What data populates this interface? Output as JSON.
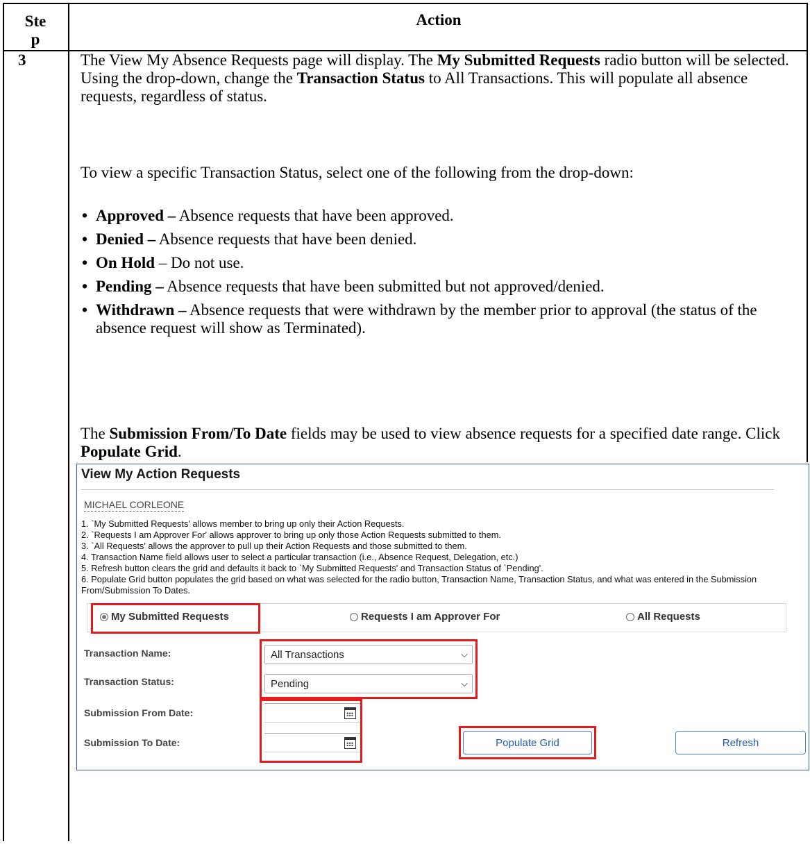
{
  "table": {
    "header_step_part1": "Ste",
    "header_step_part2": "p",
    "header_action": "Action",
    "step_number": "3"
  },
  "instructions": {
    "para1": {
      "t1": "The View My Absence Requests page will display.  The ",
      "b1": "My Submitted Requests",
      "t2": " radio button will be selected.  Using the drop-down, change the ",
      "b2": "Transaction Status",
      "t3": " to All Transactions.  This will populate all absence requests, regardless of status."
    },
    "para2": "To view a specific Transaction Status, select one of the following from the drop-down:",
    "bullets": [
      {
        "term": "Approved –",
        "desc": " Absence requests that have been approved."
      },
      {
        "term": "Denied –",
        "desc": " Absence requests that have been denied."
      },
      {
        "term": "On Hold",
        "desc": " – Do not use."
      },
      {
        "term": "Pending –",
        "desc": " Absence requests that have been submitted but not approved/denied."
      },
      {
        "term": "Withdrawn –",
        "desc": " Absence requests that were withdrawn by the member prior to approval (the status of the absence request will show as Terminated)."
      }
    ],
    "para3": {
      "t1": "The ",
      "b1": "Submission From/To Date",
      "t2": " fields may be used to view absence requests for a specified date range.  Click ",
      "b2": "Populate Grid",
      "t3": "."
    }
  },
  "screenshot": {
    "title": "View My Action Requests",
    "member_name": "MICHAEL CORLEONE",
    "notes": [
      "1. `My Submitted Requests' allows member to bring up only their Action Requests.",
      "2. `Requests I am Approver For' allows approver to bring up only those Action Requests submitted to them.",
      "3. `All Requests' allows the approver to pull up their Action Requests and those submitted to them.",
      "4. Transaction Name field allows user to select a particular transaction (i.e., Absence Request, Delegation, etc.)",
      "5. Refresh button clears the grid and defaults it back to `My Submitted Requests' and Transaction Status of `Pending'.",
      "6. Populate Grid button populates the grid based on what was selected for the radio button, Transaction Name, Transaction Status, and what was entered in the Submission From/Submission To Dates."
    ],
    "radios": {
      "my_submitted": "My Submitted Requests",
      "approver_for": "Requests I am Approver For",
      "all_requests": "All Requests",
      "selected": "my_submitted"
    },
    "labels": {
      "transaction_name": "Transaction Name:",
      "transaction_status": "Transaction Status:",
      "from_date": "Submission From Date:",
      "to_date": "Submission To Date:"
    },
    "values": {
      "transaction_name": "All Transactions",
      "transaction_status": "Pending",
      "from_date": "",
      "to_date": ""
    },
    "buttons": {
      "populate": "Populate Grid",
      "refresh": "Refresh"
    },
    "icons": {
      "calendar": "calendar-icon",
      "dropdown": "chevron-down-icon",
      "radio": "radio-button-icon"
    },
    "colors": {
      "highlight": "#e41b1b",
      "button_text": "#1e5bb8",
      "frame_border": "#2f5da8"
    }
  }
}
